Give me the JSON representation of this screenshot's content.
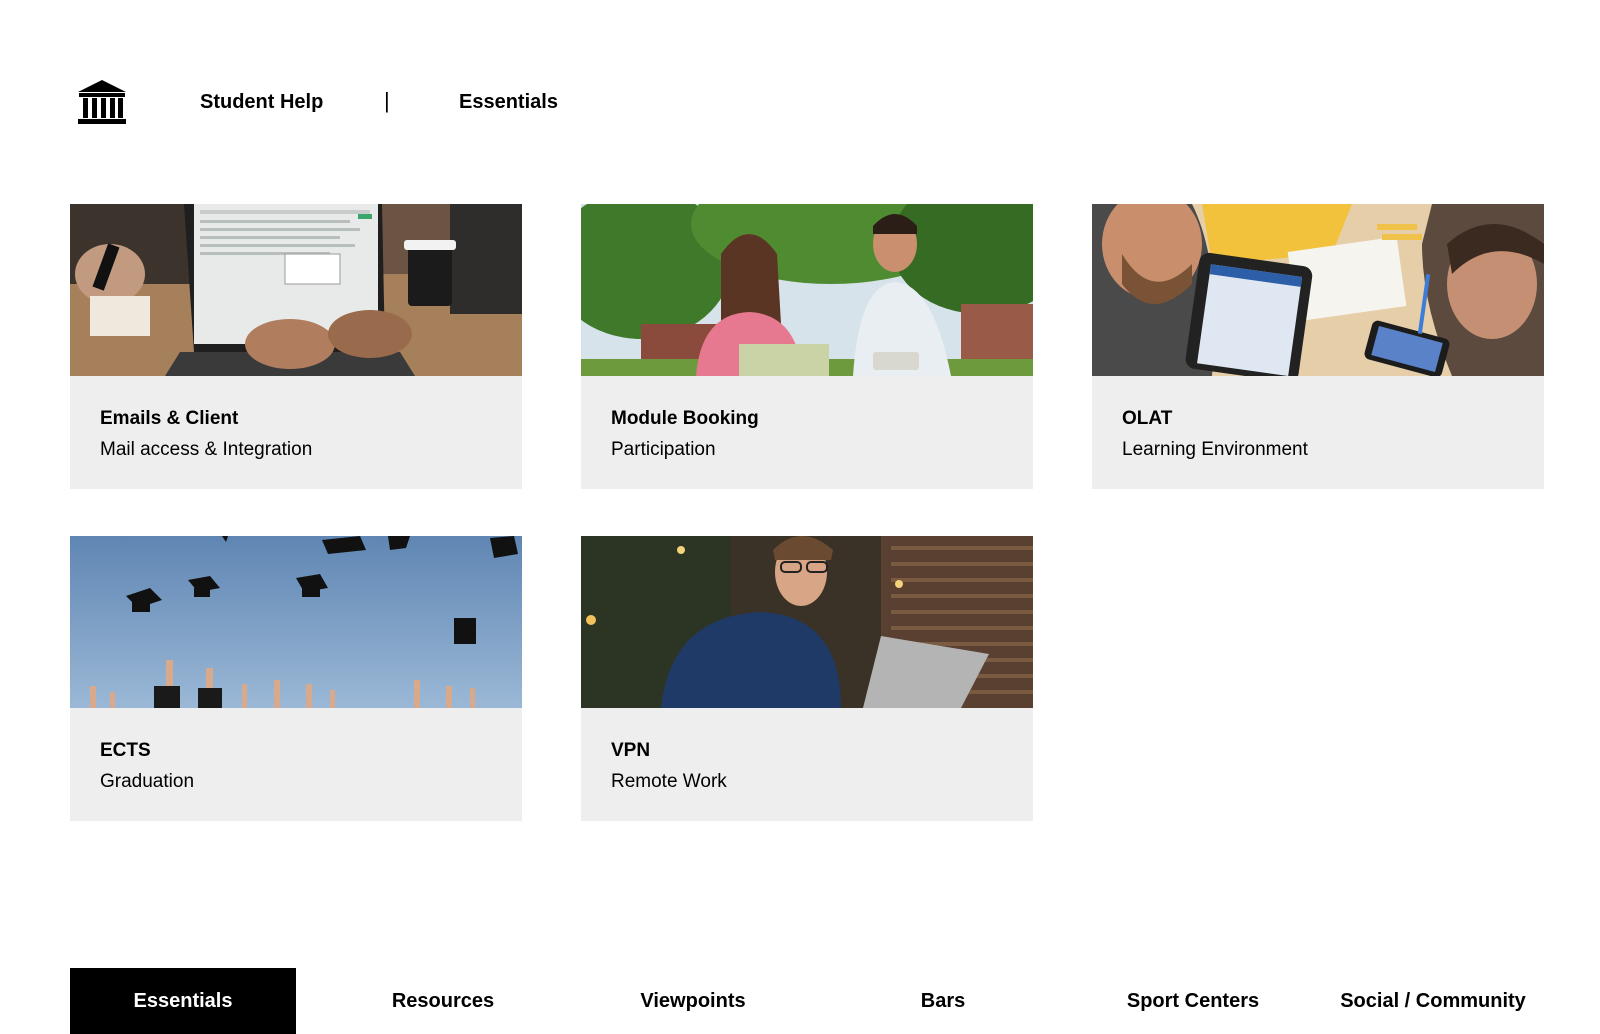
{
  "header": {
    "logo_icon": "university-building-icon",
    "student_help_label": "Student Help",
    "separator": "|",
    "essentials_label": "Essentials"
  },
  "cards": [
    {
      "title": "Emails & Client",
      "subtitle": "Mail access & Integration",
      "image_icon": "laptop-email-photo"
    },
    {
      "title": "Module Booking",
      "subtitle": "Participation",
      "image_icon": "students-outdoor-photo"
    },
    {
      "title": "OLAT",
      "subtitle": "Learning Environment",
      "image_icon": "tablet-study-photo"
    },
    {
      "title": "ECTS",
      "subtitle": "Graduation",
      "image_icon": "graduation-caps-photo"
    },
    {
      "title": "VPN",
      "subtitle": "Remote Work",
      "image_icon": "student-laptop-photo"
    }
  ],
  "bottom_nav": {
    "active_index": 0,
    "items": [
      {
        "label": "Essentials"
      },
      {
        "label": "Resources"
      },
      {
        "label": "Viewpoints"
      },
      {
        "label": "Bars"
      },
      {
        "label": "Sport Centers"
      },
      {
        "label": "Social / Community"
      }
    ]
  },
  "colors": {
    "card_background": "#eeeeee",
    "active_nav_background": "#000000",
    "active_nav_text": "#ffffff",
    "text": "#000000"
  }
}
